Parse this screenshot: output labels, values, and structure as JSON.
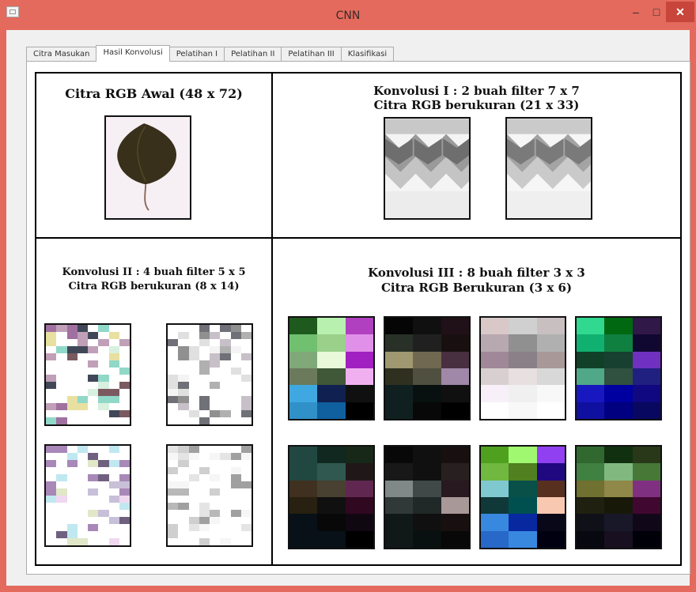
{
  "window": {
    "title": "CNN",
    "minimize_label": "–",
    "maximize_label": "□",
    "close_label": "✕"
  },
  "tabs": [
    {
      "label": "Citra Masukan"
    },
    {
      "label": "Hasil Konvolusi"
    },
    {
      "label": "Pelatihan I"
    },
    {
      "label": "Pelatihan II"
    },
    {
      "label": "Pelatihan III"
    },
    {
      "label": "Klasifikasi"
    }
  ],
  "active_tab": "Hasil Konvolusi",
  "panels": {
    "original": {
      "title": "Citra RGB Awal (48 x 72)"
    },
    "conv1": {
      "title_line1": "Konvolusi I : 2 buah filter 7 x 7",
      "title_line2": "Citra RGB berukuran (21 x 33)"
    },
    "conv2": {
      "title_line1": "Konvolusi II : 4 buah filter 5 x 5",
      "title_line2": "Citra RGB berukuran (8 x 14)"
    },
    "conv3": {
      "title_line1": "Konvolusi III : 8 buah filter 3 x 3",
      "title_line2": "Citra RGB Berukuran (3 x 6)"
    }
  },
  "feature_maps": {
    "conv3": [
      [
        [
          "#1e5a1e",
          "#b8f0b0",
          "#b040c0"
        ],
        [
          "#70c070",
          "#9ad08a",
          "#e090e8"
        ],
        [
          "#80a878",
          "#e8f8d8",
          "#a020c0"
        ],
        [
          "#6a7a5a",
          "#405838",
          "#f0b0f0"
        ],
        [
          "#40a8e0",
          "#102050",
          "#101010"
        ],
        [
          "#3090c8",
          "#1060a0",
          "#000000"
        ]
      ],
      [
        [
          "#050505",
          "#101010",
          "#201018"
        ],
        [
          "#283028",
          "#202020",
          "#181010"
        ],
        [
          "#a09870",
          "#706850",
          "#483040"
        ],
        [
          "#303020",
          "#505040",
          "#a088a8"
        ],
        [
          "#102020",
          "#081010",
          "#101010"
        ],
        [
          "#102020",
          "#080808",
          "#000000"
        ]
      ],
      [
        [
          "#d8c8c8",
          "#d0d0d0",
          "#c8c0c0"
        ],
        [
          "#b8a8b0",
          "#909090",
          "#b0b0b0"
        ],
        [
          "#a08898",
          "#8a8088",
          "#a89898"
        ],
        [
          "#d8d0d0",
          "#e8e0e0",
          "#d8d8d8"
        ],
        [
          "#f8f0f8",
          "#f0f0f0",
          "#f8f8f8"
        ],
        [
          "#ffffff",
          "#f8f8f8",
          "#ffffff"
        ]
      ],
      [
        [
          "#30d890",
          "#006810",
          "#301848"
        ],
        [
          "#10b070",
          "#108040",
          "#100830"
        ],
        [
          "#104028",
          "#184030",
          "#7030c0"
        ],
        [
          "#50a888",
          "#305040",
          "#202080"
        ],
        [
          "#1818c0",
          "#0000a0",
          "#100880"
        ],
        [
          "#1010a0",
          "#000080",
          "#080860"
        ]
      ],
      [
        [
          "#204840",
          "#102820",
          "#182818"
        ],
        [
          "#204840",
          "#305850",
          "#201818"
        ],
        [
          "#403020",
          "#484030",
          "#602850"
        ],
        [
          "#282010",
          "#101010",
          "#300820"
        ],
        [
          "#081018",
          "#080808",
          "#100810"
        ],
        [
          "#081018",
          "#081018",
          "#000000"
        ]
      ],
      [
        [
          "#080808",
          "#101010",
          "#181010"
        ],
        [
          "#181818",
          "#101010",
          "#282020"
        ],
        [
          "#808888",
          "#404848",
          "#281820"
        ],
        [
          "#303838",
          "#202828",
          "#a89898"
        ],
        [
          "#101818",
          "#101010",
          "#181010"
        ],
        [
          "#101818",
          "#081010",
          "#080808"
        ]
      ],
      [
        [
          "#50a020",
          "#a0f870",
          "#9040f0"
        ],
        [
          "#70b840",
          "#508020",
          "#200880"
        ],
        [
          "#80c8d0",
          "#085048",
          "#583020"
        ],
        [
          "#103838",
          "#005050",
          "#f8c8b0"
        ],
        [
          "#3888e0",
          "#0828a0",
          "#080818"
        ],
        [
          "#2868c8",
          "#3888e0",
          "#000010"
        ]
      ],
      [
        [
          "#306830",
          "#103010",
          "#283818"
        ],
        [
          "#408040",
          "#80b880",
          "#487838"
        ],
        [
          "#707030",
          "#908848",
          "#803080"
        ],
        [
          "#202010",
          "#181808",
          "#400830"
        ],
        [
          "#101018",
          "#181828",
          "#100818"
        ],
        [
          "#080810",
          "#181020",
          "#000008"
        ]
      ]
    ]
  }
}
